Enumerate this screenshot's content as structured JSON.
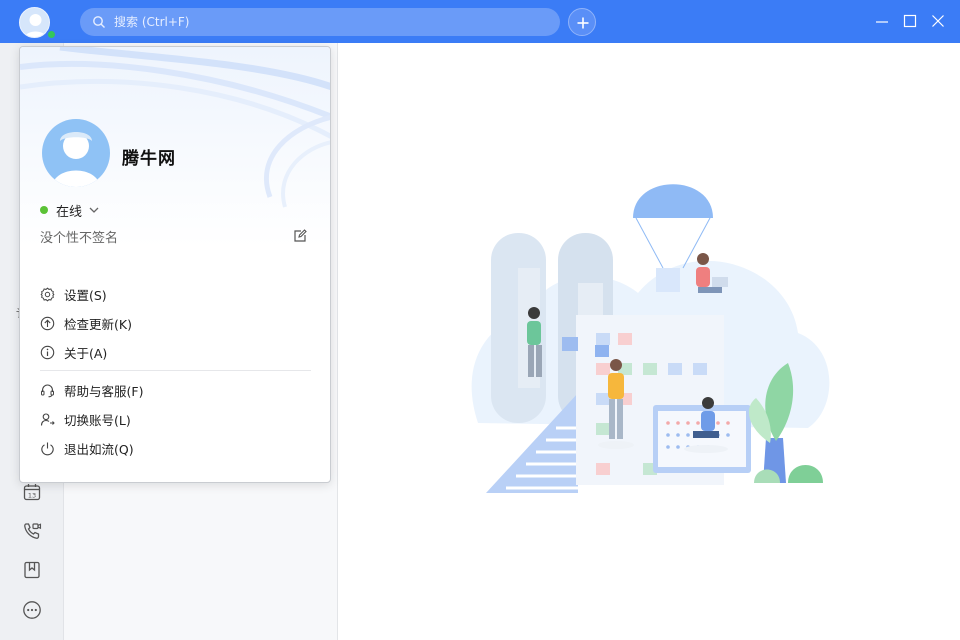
{
  "search": {
    "placeholder": "搜索 (Ctrl+F)"
  },
  "profile": {
    "name": "腾牛网",
    "status": "在线",
    "signature": "没个性不签名"
  },
  "menu": {
    "group1": [
      {
        "label": "设置(S)",
        "icon": "gear-icon"
      },
      {
        "label": "检查更新(K)",
        "icon": "update-icon"
      },
      {
        "label": "关于(A)",
        "icon": "info-icon"
      }
    ],
    "group2": [
      {
        "label": "帮助与客服(F)",
        "icon": "headset-icon"
      },
      {
        "label": "切换账号(L)",
        "icon": "switch-account-icon"
      },
      {
        "label": "退出如流(Q)",
        "icon": "power-icon"
      }
    ]
  },
  "rail": {
    "partial_label": "讠",
    "calendar_day": "13"
  },
  "colors": {
    "brand": "#3b7cf6",
    "online": "#5bc236"
  }
}
